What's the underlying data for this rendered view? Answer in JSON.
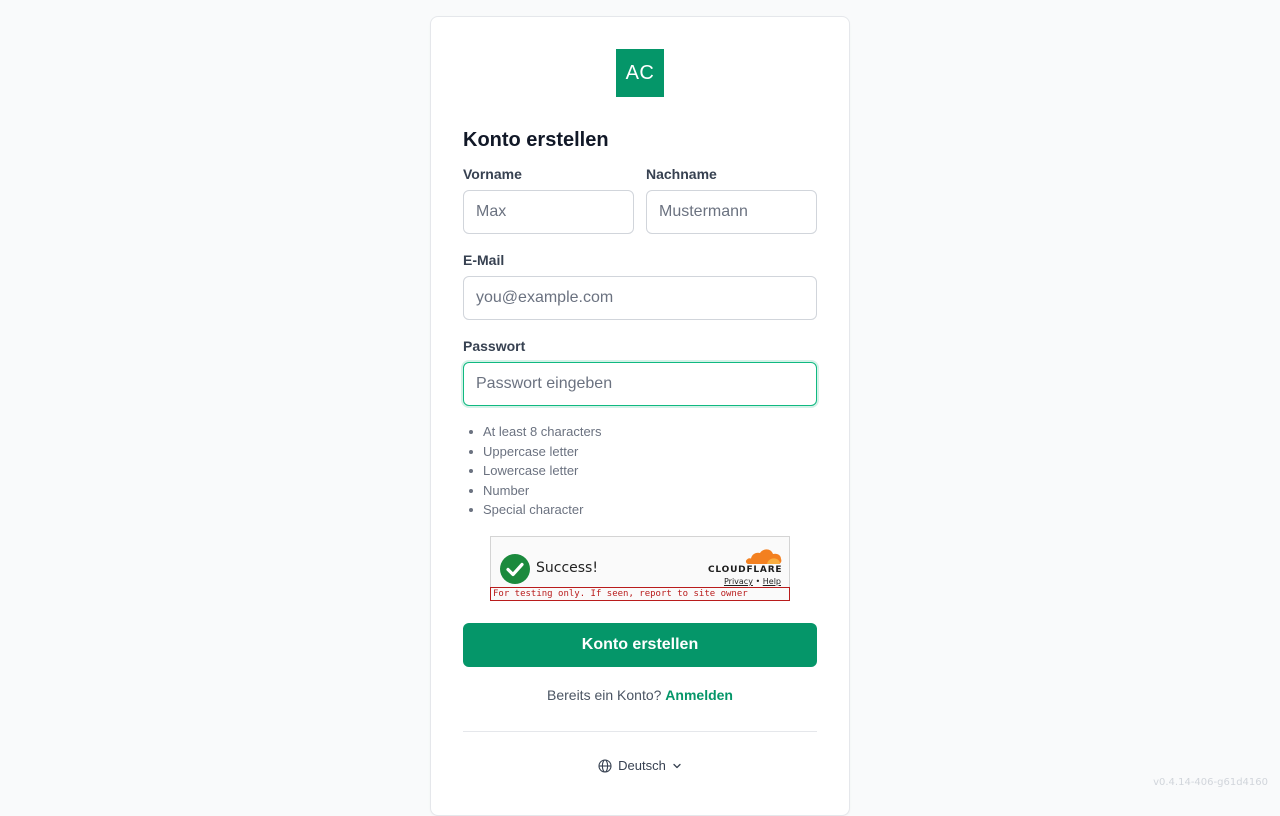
{
  "logo": {
    "text": "AC",
    "color": "#059669"
  },
  "form": {
    "title": "Konto erstellen",
    "first_name": {
      "label": "Vorname",
      "placeholder": "Max",
      "value": ""
    },
    "last_name": {
      "label": "Nachname",
      "placeholder": "Mustermann",
      "value": ""
    },
    "email": {
      "label": "E-Mail",
      "placeholder": "you@example.com",
      "value": ""
    },
    "password": {
      "label": "Passwort",
      "placeholder": "Passwort eingeben",
      "value": "",
      "focused": true
    },
    "password_rules": [
      "At least 8 characters",
      "Uppercase letter",
      "Lowercase letter",
      "Number",
      "Special character"
    ],
    "submit_label": "Konto erstellen"
  },
  "captcha": {
    "status": "Success!",
    "brand": "CLOUDFLARE",
    "privacy_link": "Privacy",
    "separator": "•",
    "help_link": "Help",
    "testing_notice": "For testing only. If seen, report to site owner"
  },
  "signin": {
    "prompt": "Bereits ein Konto?",
    "link_label": "Anmelden"
  },
  "language": {
    "icon": "globe-icon",
    "selected": "Deutsch",
    "dropdown_icon": "chevron-down-icon"
  },
  "version": "v0.4.14-406-g61d4160",
  "colors": {
    "accent": "#059669",
    "focus_ring": "#10b981",
    "captcha_success": "#1b8a3d",
    "cloudflare_orange": "#f38020"
  }
}
